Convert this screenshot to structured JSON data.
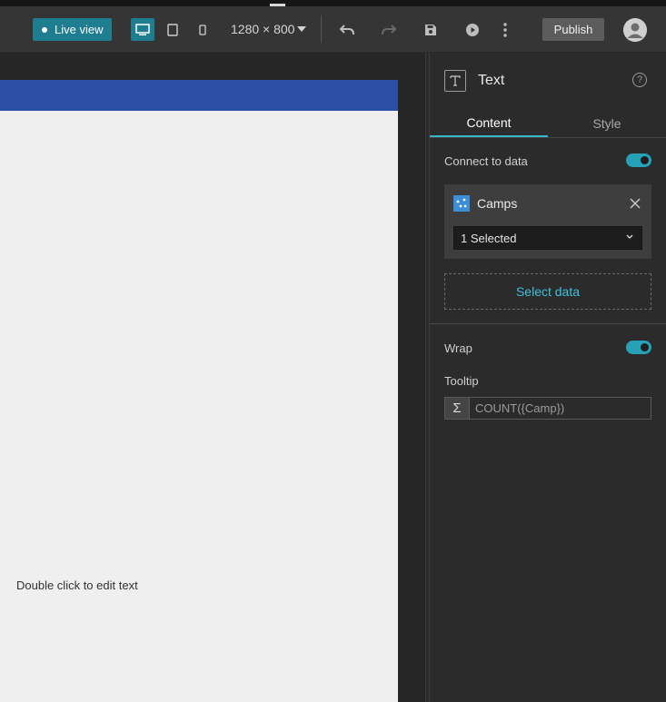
{
  "toolbar": {
    "live_view_label": "Live view",
    "resolution": "1280 × 800",
    "publish_label": "Publish"
  },
  "canvas": {
    "edit_text": "Double click to edit text"
  },
  "panel": {
    "title": "Text",
    "help": "?",
    "tabs": [
      {
        "label": "Content",
        "active": true
      },
      {
        "label": "Style",
        "active": false
      }
    ],
    "connect_to_data_label": "Connect to data",
    "connect_to_data_on": true,
    "data_source": {
      "name": "Camps",
      "selection": "1 Selected"
    },
    "select_data_label": "Select data",
    "wrap_label": "Wrap",
    "wrap_on": true,
    "tooltip_label": "Tooltip",
    "tooltip_value": "COUNT({Camp})"
  },
  "colors": {
    "accent": "#1e7d8f",
    "toggle_on": "#27a1b8",
    "link": "#3dc1dc",
    "header_bar": "#2a4fa5"
  }
}
